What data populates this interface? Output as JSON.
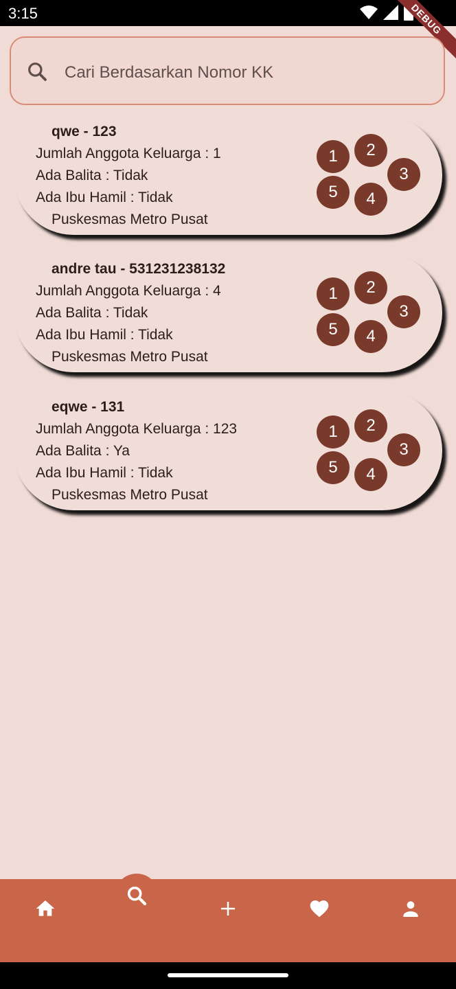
{
  "status_bar": {
    "time": "3:15",
    "debug_label": "DEBUG"
  },
  "search": {
    "placeholder": "Cari Berdasarkan Nomor KK",
    "value": ""
  },
  "cards": [
    {
      "title": "qwe - 123",
      "members": "Jumlah Anggota Keluarga : 1",
      "toddler": "Ada Balita : Tidak",
      "pregnant": "Ada Ibu Hamil : Tidak",
      "clinic": "Puskesmas Metro Pusat",
      "badges": [
        "1",
        "2",
        "3",
        "4",
        "5"
      ]
    },
    {
      "title": "andre tau - 531231238132",
      "members": "Jumlah Anggota Keluarga : 4",
      "toddler": "Ada Balita : Tidak",
      "pregnant": "Ada Ibu Hamil : Tidak",
      "clinic": "Puskesmas Metro Pusat",
      "badges": [
        "1",
        "2",
        "3",
        "4",
        "5"
      ]
    },
    {
      "title": "eqwe - 131",
      "members": "Jumlah Anggota Keluarga : 123",
      "toddler": "Ada Balita : Ya",
      "pregnant": "Ada Ibu Hamil : Tidak",
      "clinic": "Puskesmas Metro Pusat",
      "badges": [
        "1",
        "2",
        "3",
        "4",
        "5"
      ]
    }
  ],
  "bottom_nav": {
    "items": [
      {
        "icon": "home-icon"
      },
      {
        "icon": "search-icon",
        "active": true
      },
      {
        "icon": "add-icon"
      },
      {
        "icon": "heart-icon"
      },
      {
        "icon": "person-icon"
      }
    ]
  },
  "colors": {
    "background": "#f1dbd6",
    "accent": "#c96649",
    "badge": "#7a3a2b",
    "search_border": "#d88c78"
  }
}
